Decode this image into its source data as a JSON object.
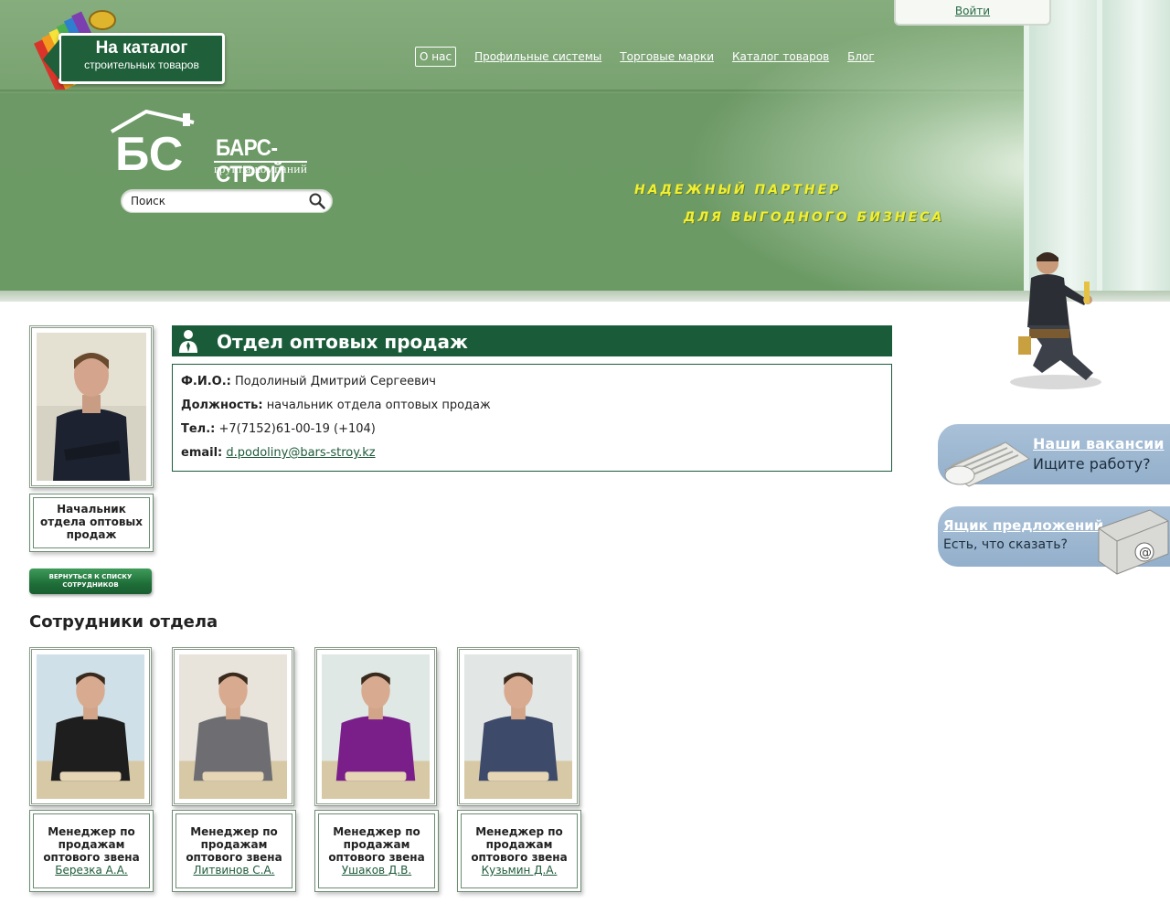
{
  "header": {
    "catalog_sign": {
      "line1": "На каталог",
      "line2": "строительных товаров"
    },
    "login_label": "Войти",
    "nav": [
      {
        "label": "О нас",
        "current": true
      },
      {
        "label": "Профильные системы"
      },
      {
        "label": "Торговые марки"
      },
      {
        "label": "Каталог товаров"
      },
      {
        "label": "Блог"
      }
    ],
    "logo": {
      "monogram": "БС",
      "name": "БАРС-СТРОЙ",
      "subtitle": "группа компаний"
    },
    "search": {
      "placeholder": "Поиск"
    },
    "slogan": {
      "line1": "надежный партнер",
      "line2": "для выгодного бизнеса"
    }
  },
  "profile": {
    "position_caption": "Начальник отдела оптовых продаж",
    "back_button": "вернуться к списку сотрудников"
  },
  "department": {
    "title": "Отдел оптовых продаж",
    "fields": [
      {
        "label": "Ф.И.О.:",
        "value": "Подолиный Дмитрий Сергеевич"
      },
      {
        "label": "Должность:",
        "value": "начальник отдела оптовых продаж"
      },
      {
        "label": "Тел.:",
        "value": "+7(7152)61-00-19 (+104)"
      },
      {
        "label": "email:",
        "value": "d.podoliny@bars-stroy.kz"
      }
    ]
  },
  "staff": {
    "heading": "Сотрудники отдела",
    "members": [
      {
        "role": "Менеджер по продажам оптового звена",
        "name": "Березка А.А.",
        "shirt": "#1e1e1e",
        "bg": "#cfe0e8"
      },
      {
        "role": "Менеджер по продажам оптового звена",
        "name": "Литвинов С.А.",
        "shirt": "#6e6e72",
        "bg": "#e8e4dc"
      },
      {
        "role": "Менеджер по продажам оптового звена",
        "name": "Ушаков Д.В.",
        "shirt": "#7a1f8a",
        "bg": "#dfe8e4"
      },
      {
        "role": "Менеджер по продажам оптового звена",
        "name": "Кузьмин Д.А.",
        "shirt": "#3e4a6a",
        "bg": "#e2e6e4"
      }
    ]
  },
  "sidebar": {
    "vacancies": {
      "title": "Наши вакансии",
      "desc": "Ищите работу?"
    },
    "suggestions": {
      "title": "Ящик предложений",
      "desc": "Есть, что сказать?"
    }
  },
  "colors": {
    "brand_green": "#1a5c3a",
    "header_green": "#6d9966",
    "slogan_yellow": "#f2ef2f",
    "card_blue": "#9db7d1"
  }
}
